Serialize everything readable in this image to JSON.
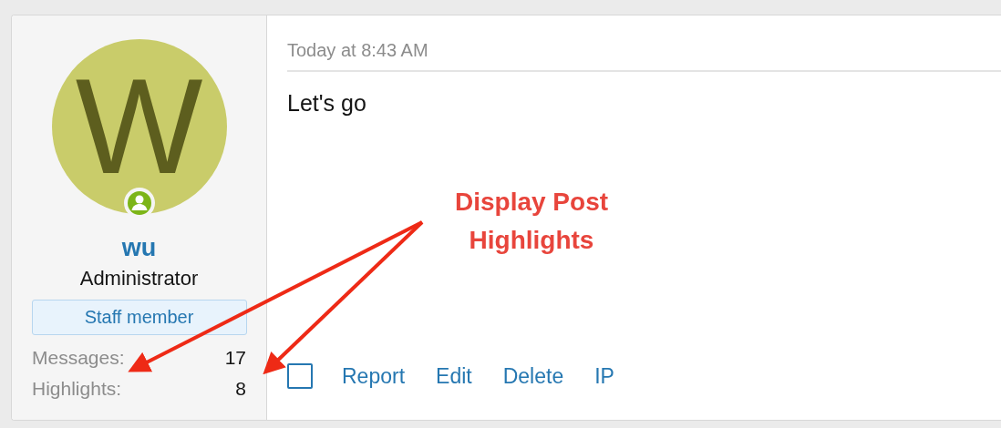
{
  "user": {
    "avatar_letter": "W",
    "online": true,
    "name": "wu",
    "title": "Administrator",
    "badge": "Staff member",
    "stats": [
      {
        "label": "Messages:",
        "value": "17"
      },
      {
        "label": "Highlights:",
        "value": "8"
      }
    ]
  },
  "post": {
    "date": "Today at 8:43 AM",
    "body": "Let's go",
    "selected": false,
    "actions": [
      "Report",
      "Edit",
      "Delete",
      "IP"
    ]
  },
  "annotation": {
    "text": "Display Post Highlights"
  }
}
